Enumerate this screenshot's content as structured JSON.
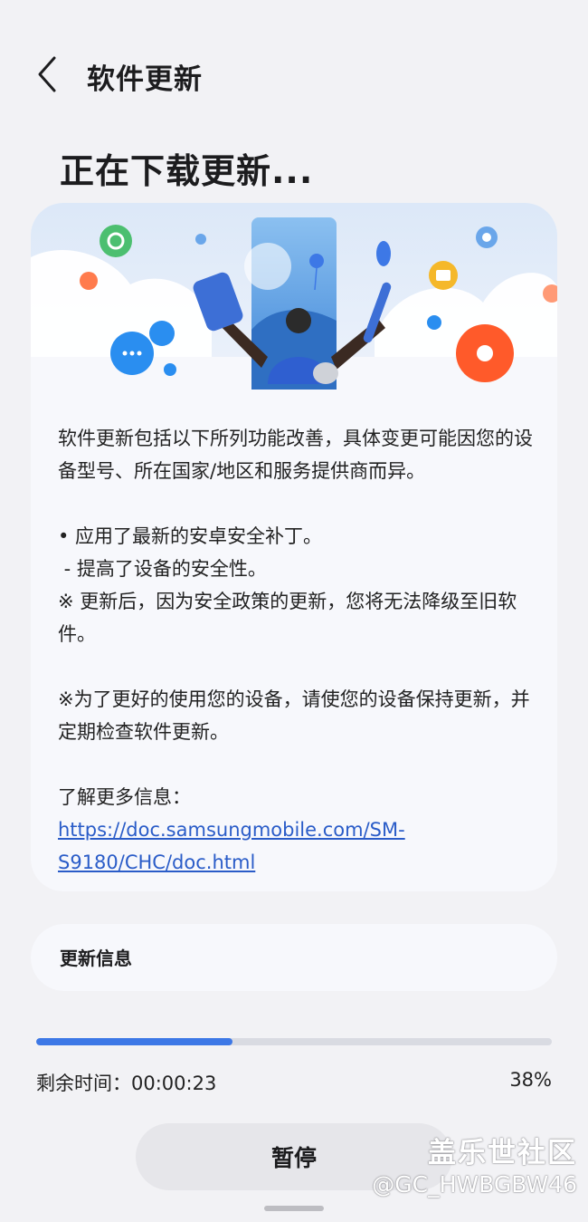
{
  "header": {
    "title": "软件更新",
    "back_icon": "chevron-left-icon"
  },
  "status": {
    "headline": "正在下载更新..."
  },
  "description": {
    "intro": "软件更新包括以下所列功能改善，具体变更可能因您的设备型号、所在国家/地区和服务提供商而异。",
    "bullet1": "• 应用了最新的安卓安全补丁。",
    "bullet1_sub": " - 提高了设备的安全性。",
    "note1": "※ 更新后，因为安全政策的更新，您将无法降级至旧软件。",
    "note2": "※为了更好的使用您的设备，请使您的设备保持更新，并定期检查软件更新。",
    "more_label": "了解更多信息：",
    "link_text": "https://doc.samsungmobile.com/SM-S9180/CHC/doc.html"
  },
  "update_info": {
    "label": "更新信息"
  },
  "progress": {
    "fraction": 0.38,
    "remaining_label": "剩余时间：",
    "remaining_time": "00:00:23",
    "percent_text": "38%"
  },
  "actions": {
    "pause_label": "暂停"
  },
  "watermark": {
    "line1": "盖乐世社区",
    "line2": "@GC_HWBGBW46"
  },
  "colors": {
    "accent": "#3d78e6",
    "background": "#f2f2f5",
    "card": "#f7f8fc",
    "link": "#2a5cc8"
  }
}
